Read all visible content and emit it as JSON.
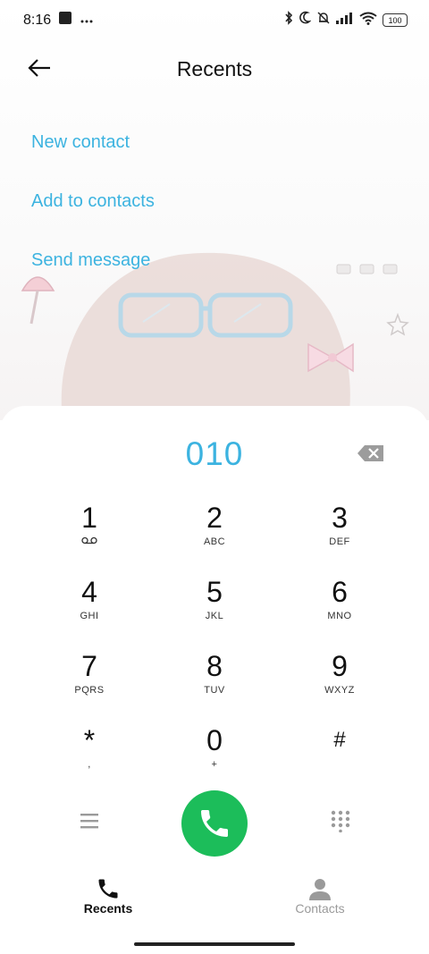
{
  "status_bar": {
    "time": "8:16",
    "battery": "100",
    "icons": [
      "square-icon",
      "more-icon",
      "bluetooth-icon",
      "moon-icon",
      "bell-off-icon",
      "signal-icon",
      "wifi-icon",
      "battery-icon"
    ]
  },
  "header": {
    "title": "Recents",
    "back_icon": "arrow-left-icon"
  },
  "menu": {
    "new_contact": "New contact",
    "add_to_contacts": "Add to contacts",
    "send_message": "Send message"
  },
  "dialer": {
    "number": "010",
    "keys": [
      {
        "digit": "1",
        "letters": ""
      },
      {
        "digit": "2",
        "letters": "ABC"
      },
      {
        "digit": "3",
        "letters": "DEF"
      },
      {
        "digit": "4",
        "letters": "GHI"
      },
      {
        "digit": "5",
        "letters": "JKL"
      },
      {
        "digit": "6",
        "letters": "MNO"
      },
      {
        "digit": "7",
        "letters": "PQRS"
      },
      {
        "digit": "8",
        "letters": "TUV"
      },
      {
        "digit": "9",
        "letters": "WXYZ"
      },
      {
        "digit": "*",
        "letters": ","
      },
      {
        "digit": "0",
        "letters": "+"
      },
      {
        "digit": "#",
        "letters": ""
      }
    ]
  },
  "tabs": {
    "recents": "Recents",
    "contacts": "Contacts"
  },
  "colors": {
    "accent": "#3cb3e0",
    "call": "#1cbd5a",
    "inactive": "#9a9a9a"
  }
}
